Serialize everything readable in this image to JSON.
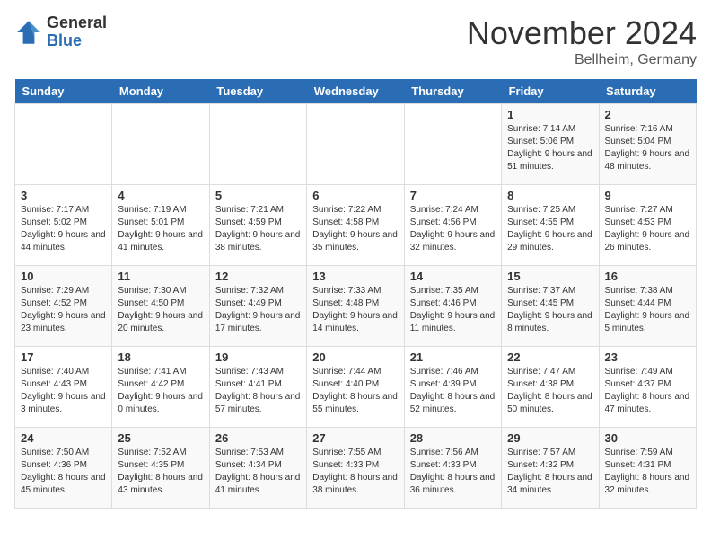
{
  "logo": {
    "general": "General",
    "blue": "Blue"
  },
  "header": {
    "month": "November 2024",
    "location": "Bellheim, Germany"
  },
  "weekdays": [
    "Sunday",
    "Monday",
    "Tuesday",
    "Wednesday",
    "Thursday",
    "Friday",
    "Saturday"
  ],
  "weeks": [
    [
      {
        "day": "",
        "info": ""
      },
      {
        "day": "",
        "info": ""
      },
      {
        "day": "",
        "info": ""
      },
      {
        "day": "",
        "info": ""
      },
      {
        "day": "",
        "info": ""
      },
      {
        "day": "1",
        "info": "Sunrise: 7:14 AM\nSunset: 5:06 PM\nDaylight: 9 hours\nand 51 minutes."
      },
      {
        "day": "2",
        "info": "Sunrise: 7:16 AM\nSunset: 5:04 PM\nDaylight: 9 hours\nand 48 minutes."
      }
    ],
    [
      {
        "day": "3",
        "info": "Sunrise: 7:17 AM\nSunset: 5:02 PM\nDaylight: 9 hours\nand 44 minutes."
      },
      {
        "day": "4",
        "info": "Sunrise: 7:19 AM\nSunset: 5:01 PM\nDaylight: 9 hours\nand 41 minutes."
      },
      {
        "day": "5",
        "info": "Sunrise: 7:21 AM\nSunset: 4:59 PM\nDaylight: 9 hours\nand 38 minutes."
      },
      {
        "day": "6",
        "info": "Sunrise: 7:22 AM\nSunset: 4:58 PM\nDaylight: 9 hours\nand 35 minutes."
      },
      {
        "day": "7",
        "info": "Sunrise: 7:24 AM\nSunset: 4:56 PM\nDaylight: 9 hours\nand 32 minutes."
      },
      {
        "day": "8",
        "info": "Sunrise: 7:25 AM\nSunset: 4:55 PM\nDaylight: 9 hours\nand 29 minutes."
      },
      {
        "day": "9",
        "info": "Sunrise: 7:27 AM\nSunset: 4:53 PM\nDaylight: 9 hours\nand 26 minutes."
      }
    ],
    [
      {
        "day": "10",
        "info": "Sunrise: 7:29 AM\nSunset: 4:52 PM\nDaylight: 9 hours\nand 23 minutes."
      },
      {
        "day": "11",
        "info": "Sunrise: 7:30 AM\nSunset: 4:50 PM\nDaylight: 9 hours\nand 20 minutes."
      },
      {
        "day": "12",
        "info": "Sunrise: 7:32 AM\nSunset: 4:49 PM\nDaylight: 9 hours\nand 17 minutes."
      },
      {
        "day": "13",
        "info": "Sunrise: 7:33 AM\nSunset: 4:48 PM\nDaylight: 9 hours\nand 14 minutes."
      },
      {
        "day": "14",
        "info": "Sunrise: 7:35 AM\nSunset: 4:46 PM\nDaylight: 9 hours\nand 11 minutes."
      },
      {
        "day": "15",
        "info": "Sunrise: 7:37 AM\nSunset: 4:45 PM\nDaylight: 9 hours\nand 8 minutes."
      },
      {
        "day": "16",
        "info": "Sunrise: 7:38 AM\nSunset: 4:44 PM\nDaylight: 9 hours\nand 5 minutes."
      }
    ],
    [
      {
        "day": "17",
        "info": "Sunrise: 7:40 AM\nSunset: 4:43 PM\nDaylight: 9 hours\nand 3 minutes."
      },
      {
        "day": "18",
        "info": "Sunrise: 7:41 AM\nSunset: 4:42 PM\nDaylight: 9 hours\nand 0 minutes."
      },
      {
        "day": "19",
        "info": "Sunrise: 7:43 AM\nSunset: 4:41 PM\nDaylight: 8 hours\nand 57 minutes."
      },
      {
        "day": "20",
        "info": "Sunrise: 7:44 AM\nSunset: 4:40 PM\nDaylight: 8 hours\nand 55 minutes."
      },
      {
        "day": "21",
        "info": "Sunrise: 7:46 AM\nSunset: 4:39 PM\nDaylight: 8 hours\nand 52 minutes."
      },
      {
        "day": "22",
        "info": "Sunrise: 7:47 AM\nSunset: 4:38 PM\nDaylight: 8 hours\nand 50 minutes."
      },
      {
        "day": "23",
        "info": "Sunrise: 7:49 AM\nSunset: 4:37 PM\nDaylight: 8 hours\nand 47 minutes."
      }
    ],
    [
      {
        "day": "24",
        "info": "Sunrise: 7:50 AM\nSunset: 4:36 PM\nDaylight: 8 hours\nand 45 minutes."
      },
      {
        "day": "25",
        "info": "Sunrise: 7:52 AM\nSunset: 4:35 PM\nDaylight: 8 hours\nand 43 minutes."
      },
      {
        "day": "26",
        "info": "Sunrise: 7:53 AM\nSunset: 4:34 PM\nDaylight: 8 hours\nand 41 minutes."
      },
      {
        "day": "27",
        "info": "Sunrise: 7:55 AM\nSunset: 4:33 PM\nDaylight: 8 hours\nand 38 minutes."
      },
      {
        "day": "28",
        "info": "Sunrise: 7:56 AM\nSunset: 4:33 PM\nDaylight: 8 hours\nand 36 minutes."
      },
      {
        "day": "29",
        "info": "Sunrise: 7:57 AM\nSunset: 4:32 PM\nDaylight: 8 hours\nand 34 minutes."
      },
      {
        "day": "30",
        "info": "Sunrise: 7:59 AM\nSunset: 4:31 PM\nDaylight: 8 hours\nand 32 minutes."
      }
    ]
  ]
}
